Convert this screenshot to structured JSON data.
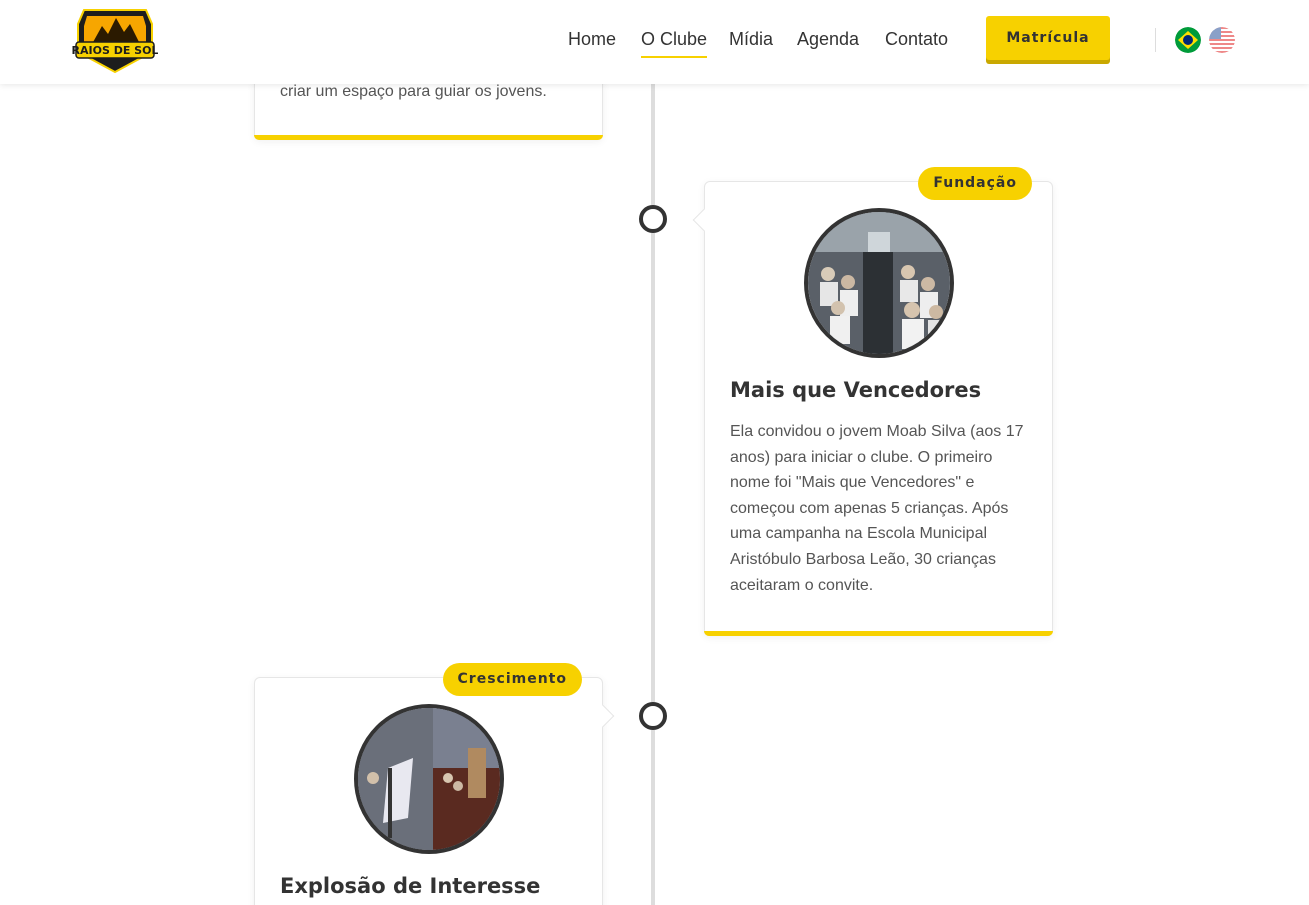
{
  "header": {
    "logo_text": "RAIOS DE SOL",
    "nav": [
      "Home",
      "O Clube",
      "Mídia",
      "Agenda",
      "Contato"
    ],
    "active_nav": "O Clube",
    "cta_label": "Matrícula",
    "languages": [
      "pt-BR flag",
      "en-US flag"
    ]
  },
  "timeline": {
    "cards": [
      {
        "text_fragment": "criar um espaço para guiar os jovens."
      },
      {
        "badge": "Fundação",
        "title": "Mais que Vencedores",
        "text": "Ela convidou o jovem Moab Silva (aos 17 anos) para iniciar o clube. O primeiro nome foi \"Mais que Vencedores\" e começou com apenas 5 crianças. Após uma campanha na Escola Municipal Aristóbulo Barbosa Leão, 30 crianças aceitaram o convite."
      },
      {
        "badge": "Crescimento",
        "title": "Explosão de Interesse"
      }
    ]
  },
  "colors": {
    "accent": "#f7d100",
    "text": "#333333",
    "timeline_line": "#dddddd"
  },
  "icons": {
    "logo": "raios-de-sol-logo",
    "flag_br": "brazil-flag-icon",
    "flag_us": "usa-flag-icon"
  }
}
